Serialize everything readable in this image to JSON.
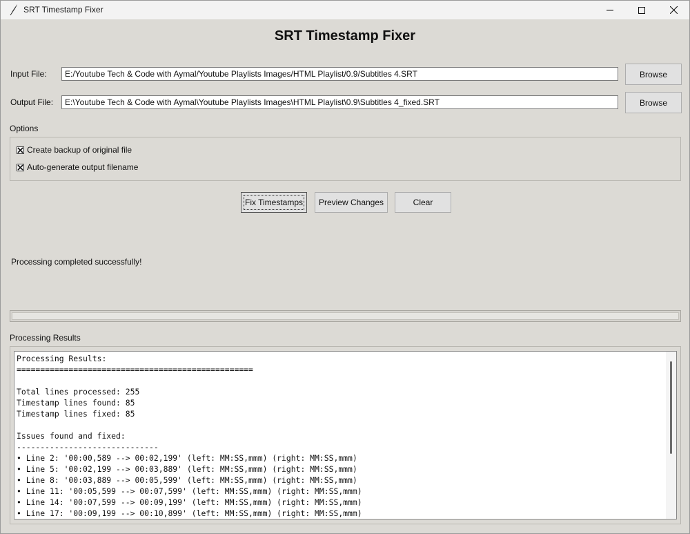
{
  "window": {
    "title": "SRT Timestamp Fixer",
    "icons": {
      "app": "feather-icon",
      "minimize": "minimize-icon",
      "maximize": "maximize-icon",
      "close": "close-icon"
    }
  },
  "heading": "SRT Timestamp Fixer",
  "input": {
    "label": "Input File:",
    "value": "E:/Youtube Tech & Code with Aymal/Youtube Playlists Images/HTML Playlist/0.9/Subtitles 4.SRT",
    "browse_label": "Browse"
  },
  "output": {
    "label": "Output File:",
    "value": "E:\\Youtube Tech & Code with Aymal\\Youtube Playlists Images\\HTML Playlist\\0.9\\Subtitles 4_fixed.SRT",
    "browse_label": "Browse"
  },
  "options": {
    "title": "Options",
    "backup": {
      "label": "Create backup of original file",
      "checked": true
    },
    "autogen": {
      "label": "Auto-generate output filename",
      "checked": true
    }
  },
  "actions": {
    "fix": "Fix Timestamps",
    "preview": "Preview Changes",
    "clear": "Clear"
  },
  "status": "Processing completed successfully!",
  "progress": {
    "fraction": 0
  },
  "results": {
    "title": "Processing Results",
    "text": "Processing Results:\n==================================================\n\nTotal lines processed: 255\nTimestamp lines found: 85\nTimestamp lines fixed: 85\n\nIssues found and fixed:\n------------------------------\n• Line 2: '00:00,589 --> 00:02,199' (left: MM:SS,mmm) (right: MM:SS,mmm)\n• Line 5: '00:02,199 --> 00:03,889' (left: MM:SS,mmm) (right: MM:SS,mmm)\n• Line 8: '00:03,889 --> 00:05,599' (left: MM:SS,mmm) (right: MM:SS,mmm)\n• Line 11: '00:05,599 --> 00:07,599' (left: MM:SS,mmm) (right: MM:SS,mmm)\n• Line 14: '00:07,599 --> 00:09,199' (left: MM:SS,mmm) (right: MM:SS,mmm)\n• Line 17: '00:09,199 --> 00:10,899' (left: MM:SS,mmm) (right: MM:SS,mmm)"
  }
}
